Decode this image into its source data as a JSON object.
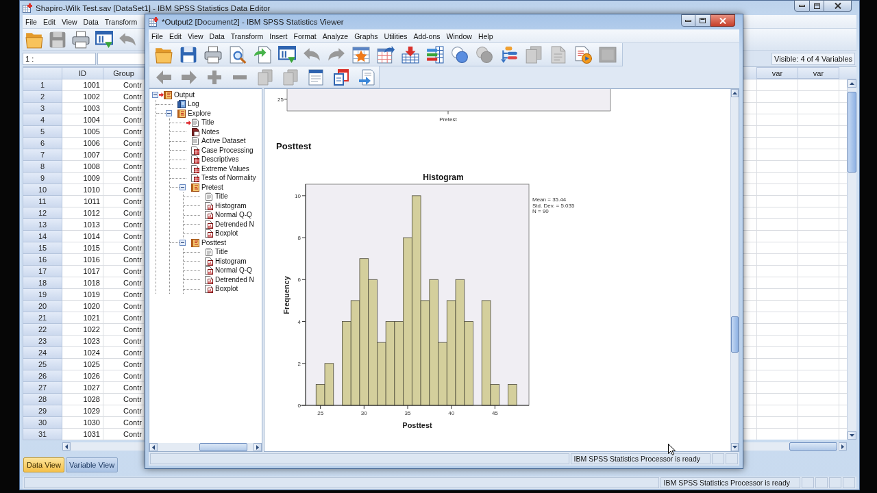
{
  "data_editor": {
    "title": "Shapiro-Wilk Test.sav [DataSet1] - IBM SPSS Statistics Data Editor",
    "menu": [
      "File",
      "Edit",
      "View",
      "Data",
      "Transform"
    ],
    "toolbar": [
      {
        "kind": "folder",
        "disabled": false
      },
      {
        "kind": "floppy",
        "disabled": true
      },
      {
        "kind": "printer",
        "disabled": false
      },
      {
        "kind": "window-arrow",
        "disabled": false
      },
      {
        "kind": "undo",
        "disabled": true
      }
    ],
    "cell_reference": "1 :",
    "visible_variables": "Visible: 4 of 4 Variables",
    "columns": [
      "ID",
      "Group"
    ],
    "extra_columns": [
      "var",
      "var"
    ],
    "rows": [
      {
        "number": "1",
        "cells": [
          "1001",
          "Contr"
        ]
      },
      {
        "number": "2",
        "cells": [
          "1002",
          "Contr"
        ]
      },
      {
        "number": "3",
        "cells": [
          "1003",
          "Contr"
        ]
      },
      {
        "number": "4",
        "cells": [
          "1004",
          "Contr"
        ]
      },
      {
        "number": "5",
        "cells": [
          "1005",
          "Contr"
        ]
      },
      {
        "number": "6",
        "cells": [
          "1006",
          "Contr"
        ]
      },
      {
        "number": "7",
        "cells": [
          "1007",
          "Contr"
        ]
      },
      {
        "number": "8",
        "cells": [
          "1008",
          "Contr"
        ]
      },
      {
        "number": "9",
        "cells": [
          "1009",
          "Contr"
        ]
      },
      {
        "number": "10",
        "cells": [
          "1010",
          "Contr"
        ]
      },
      {
        "number": "11",
        "cells": [
          "1011",
          "Contr"
        ]
      },
      {
        "number": "12",
        "cells": [
          "1012",
          "Contr"
        ]
      },
      {
        "number": "13",
        "cells": [
          "1013",
          "Contr"
        ]
      },
      {
        "number": "14",
        "cells": [
          "1014",
          "Contr"
        ]
      },
      {
        "number": "15",
        "cells": [
          "1015",
          "Contr"
        ]
      },
      {
        "number": "16",
        "cells": [
          "1016",
          "Contr"
        ]
      },
      {
        "number": "17",
        "cells": [
          "1017",
          "Contr"
        ]
      },
      {
        "number": "18",
        "cells": [
          "1018",
          "Contr"
        ]
      },
      {
        "number": "19",
        "cells": [
          "1019",
          "Contr"
        ]
      },
      {
        "number": "20",
        "cells": [
          "1020",
          "Contr"
        ]
      },
      {
        "number": "21",
        "cells": [
          "1021",
          "Contr"
        ]
      },
      {
        "number": "22",
        "cells": [
          "1022",
          "Contr"
        ]
      },
      {
        "number": "23",
        "cells": [
          "1023",
          "Contr"
        ]
      },
      {
        "number": "24",
        "cells": [
          "1024",
          "Contr"
        ]
      },
      {
        "number": "25",
        "cells": [
          "1025",
          "Contr"
        ]
      },
      {
        "number": "26",
        "cells": [
          "1026",
          "Contr"
        ]
      },
      {
        "number": "27",
        "cells": [
          "1027",
          "Contr"
        ]
      },
      {
        "number": "28",
        "cells": [
          "1028",
          "Contr"
        ]
      },
      {
        "number": "29",
        "cells": [
          "1029",
          "Contr"
        ]
      },
      {
        "number": "30",
        "cells": [
          "1030",
          "Contr"
        ]
      },
      {
        "number": "31",
        "cells": [
          "1031",
          "Contr"
        ]
      }
    ],
    "tabs": [
      {
        "label": "Data View",
        "selected": true
      },
      {
        "label": "Variable View",
        "selected": false
      }
    ],
    "status": "IBM SPSS Statistics Processor is ready"
  },
  "viewer": {
    "title": "*Output2 [Document2] - IBM SPSS Statistics Viewer",
    "menu": [
      "File",
      "Edit",
      "View",
      "Data",
      "Transform",
      "Insert",
      "Format",
      "Analyze",
      "Graphs",
      "Utilities",
      "Add-ons",
      "Window",
      "Help"
    ],
    "toolbar_1": [
      {
        "kind": "folder",
        "disabled": false
      },
      {
        "kind": "floppy",
        "disabled": false
      },
      {
        "kind": "printer",
        "disabled": false
      },
      {
        "kind": "magnifier-page",
        "disabled": false
      },
      {
        "kind": "page-arrow",
        "disabled": false
      },
      {
        "kind": "window-arrow",
        "disabled": false
      },
      {
        "kind": "undo",
        "disabled": true
      },
      {
        "kind": "redo",
        "disabled": true
      },
      {
        "kind": "star-grid",
        "disabled": false
      },
      {
        "kind": "grid-arrow",
        "disabled": false
      },
      {
        "kind": "grid-down-arrow",
        "disabled": false
      },
      {
        "kind": "bars-grid",
        "disabled": false
      },
      {
        "kind": "circles",
        "disabled": false
      },
      {
        "kind": "circles",
        "disabled": true
      },
      {
        "kind": "tree-list",
        "disabled": false
      },
      {
        "kind": "page-stack",
        "disabled": true
      },
      {
        "kind": "page",
        "disabled": true
      },
      {
        "kind": "page-badge",
        "disabled": false
      },
      {
        "kind": "square",
        "disabled": true
      }
    ],
    "toolbar_2": [
      {
        "kind": "left-arrow",
        "disabled": true
      },
      {
        "kind": "right-arrow",
        "disabled": true
      },
      {
        "kind": "plus",
        "disabled": true
      },
      {
        "kind": "minus",
        "disabled": true
      },
      {
        "kind": "page-stack",
        "disabled": true
      },
      {
        "kind": "page-stack",
        "disabled": true
      },
      {
        "kind": "header-page",
        "disabled": false
      },
      {
        "kind": "pages",
        "disabled": false
      },
      {
        "kind": "page-swap",
        "disabled": false
      }
    ],
    "outline": [
      {
        "label": "Output",
        "kind": "book",
        "expanded": true,
        "selected": true,
        "children": [
          {
            "label": "Log",
            "kind": "log",
            "selected": false
          },
          {
            "label": "Explore",
            "kind": "book",
            "expanded": true,
            "selected": false,
            "children": [
              {
                "label": "Title",
                "kind": "title",
                "selected": true
              },
              {
                "label": "Notes",
                "kind": "notes",
                "selected": false
              },
              {
                "label": "Active Dataset",
                "kind": "text",
                "selected": false
              },
              {
                "label": "Case Processing",
                "kind": "table",
                "selected": false
              },
              {
                "label": "Descriptives",
                "kind": "table",
                "selected": false
              },
              {
                "label": "Extreme Values",
                "kind": "table",
                "selected": false
              },
              {
                "label": "Tests of Normality",
                "kind": "table",
                "selected": false
              },
              {
                "label": "Pretest",
                "kind": "book",
                "expanded": true,
                "selected": false,
                "children": [
                  {
                    "label": "Title",
                    "kind": "title",
                    "selected": false
                  },
                  {
                    "label": "Histogram",
                    "kind": "chart",
                    "selected": false
                  },
                  {
                    "label": "Normal Q-Q",
                    "kind": "chart",
                    "selected": false
                  },
                  {
                    "label": "Detrended N",
                    "kind": "chart",
                    "selected": false
                  },
                  {
                    "label": "Boxplot",
                    "kind": "chart",
                    "selected": false
                  }
                ]
              },
              {
                "label": "Posttest",
                "kind": "book",
                "expanded": true,
                "selected": false,
                "children": [
                  {
                    "label": "Title",
                    "kind": "title",
                    "selected": false
                  },
                  {
                    "label": "Histogram",
                    "kind": "chart",
                    "selected": false
                  },
                  {
                    "label": "Normal Q-Q",
                    "kind": "chart",
                    "selected": false
                  },
                  {
                    "label": "Detrended N",
                    "kind": "chart",
                    "selected": false
                  },
                  {
                    "label": "Boxplot",
                    "kind": "chart",
                    "selected": false
                  }
                ]
              }
            ]
          }
        ]
      }
    ],
    "output": {
      "previous_chart": {
        "ytick_label": "25",
        "category_label": "Pretest"
      },
      "heading": "Posttest",
      "chart_data": {
        "type": "bar",
        "title": "Histogram",
        "xlabel": "Posttest",
        "ylabel": "Frequency",
        "x": [
          25,
          26,
          27,
          28,
          29,
          30,
          31,
          32,
          33,
          34,
          35,
          36,
          37,
          38,
          39,
          40,
          41,
          42,
          43,
          44,
          45,
          46,
          47
        ],
        "values": [
          1,
          2,
          0,
          4,
          5,
          7,
          6,
          3,
          4,
          4,
          8,
          10,
          5,
          6,
          3,
          5,
          6,
          4,
          0,
          5,
          1,
          0,
          1
        ],
        "xlim": [
          23.3,
          48.9
        ],
        "ylim": [
          0,
          10.55
        ],
        "xticks": [
          25,
          30,
          35,
          40,
          45
        ],
        "yticks": [
          0,
          2,
          4,
          6,
          8,
          10
        ],
        "annotations": [
          "Mean = 35.44",
          "Std. Dev. = 5.035",
          "N = 90"
        ]
      }
    },
    "status": "IBM SPSS Statistics Processor is ready"
  }
}
